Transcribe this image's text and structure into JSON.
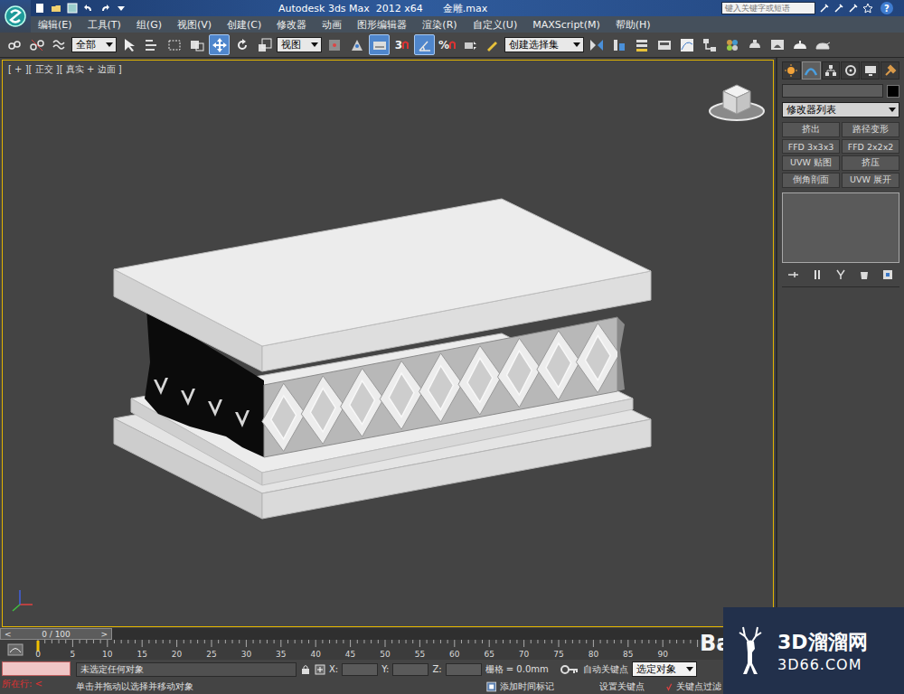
{
  "title_bar": {
    "app": "Autodesk 3ds Max  2012 x64",
    "file": "金雕.max",
    "search_placeholder": "键入关键字或短语",
    "help": "?"
  },
  "menu": [
    "编辑(E)",
    "工具(T)",
    "组(G)",
    "视图(V)",
    "创建(C)",
    "修改器",
    "动画",
    "图形编辑器",
    "渲染(R)",
    "自定义(U)",
    "MAXScript(M)",
    "帮助(H)"
  ],
  "toolbar": {
    "selection_filter": "全部",
    "reference_coord": "视图",
    "snap_toggle": "3",
    "percent_snap": "%",
    "named_selection": "创建选择集",
    "tools": [
      {
        "selected": false
      },
      {
        "selected": false
      },
      {
        "selected": false
      },
      {
        "selected": false
      },
      {
        "selected": false
      },
      {
        "selected": false
      },
      {
        "selected": false
      },
      {
        "selected": true
      },
      {
        "selected": false
      },
      {
        "selected": false
      },
      {
        "selected": false
      },
      {
        "selected": false
      },
      {
        "selected": true
      },
      {
        "selected": false
      },
      {
        "selected": true
      },
      {
        "selected": false
      },
      {
        "selected": false
      },
      {
        "selected": false
      },
      {
        "selected": false
      },
      {
        "selected": false
      },
      {
        "selected": false
      },
      {
        "selected": false
      },
      {
        "selected": false
      },
      {
        "selected": false
      },
      {
        "selected": false
      },
      {
        "selected": false
      },
      {
        "selected": false
      },
      {
        "selected": false
      },
      {
        "selected": false
      }
    ]
  },
  "viewport": {
    "label": "[ + ][ 正交 ][ 真实 + 边面 ]",
    "active": true
  },
  "command_panel": {
    "tabs": [
      {
        "selected": false
      },
      {
        "selected": true
      },
      {
        "selected": false
      },
      {
        "selected": false
      },
      {
        "selected": false
      },
      {
        "selected": false
      }
    ],
    "object_name": "",
    "object_color": "#000000",
    "modifier_list": "修改器列表",
    "modifier_buttons": [
      "挤出",
      "路径变形",
      "FFD 3x3x3",
      "FFD 2x2x2",
      "UVW 贴图",
      "挤压",
      "倒角剖面",
      "UVW 展开"
    ]
  },
  "time_slider": {
    "prev": "<",
    "reading": "0 / 100",
    "next": ">",
    "level": 0
  },
  "ruler": {
    "ticks": [
      "0",
      "5",
      "10",
      "15",
      "20",
      "25",
      "30",
      "35",
      "40",
      "45",
      "50",
      "55",
      "60",
      "65",
      "70",
      "75",
      "80",
      "85",
      "90"
    ]
  },
  "status": {
    "script_listener": "所在行: <",
    "selection": "未选定任何对象",
    "prompt": "单击并拖动以选择并移动对象",
    "coords": [
      {
        "axis": "X:",
        "value": ""
      },
      {
        "axis": "Y:",
        "value": ""
      },
      {
        "axis": "Z:",
        "value": ""
      }
    ],
    "grid": "栅格 = 0.0mm",
    "auto_key": "自动关键点",
    "key_mode": "选定对象",
    "set_key": "设置关键点",
    "add_time_tag": "添加时间标记",
    "key_filter": "关键点过滤"
  },
  "watermark": {
    "partial": "Ba",
    "brand": "3D溜溜网",
    "url": "3D66.COM"
  }
}
